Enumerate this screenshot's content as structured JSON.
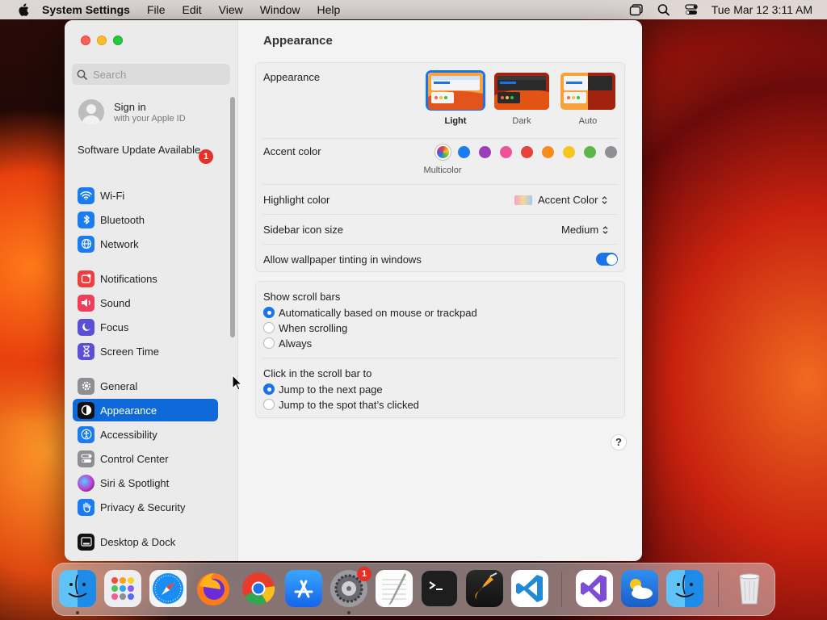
{
  "menubar": {
    "app_name": "System Settings",
    "menus": [
      "File",
      "Edit",
      "View",
      "Window",
      "Help"
    ],
    "datetime": "Tue Mar 12  3:11 AM"
  },
  "sidebar": {
    "search_placeholder": "Search",
    "signin_title": "Sign in",
    "signin_subtitle": "with your Apple ID",
    "update_label": "Software Update Available",
    "update_count": "1",
    "items": [
      {
        "label": "Wi-Fi",
        "icon": "wifi-icon",
        "color": "#1a7cf0"
      },
      {
        "label": "Bluetooth",
        "icon": "bluetooth-icon",
        "color": "#1a7cf0"
      },
      {
        "label": "Network",
        "icon": "globe-icon",
        "color": "#1a7cf0"
      },
      {
        "label": "Notifications",
        "icon": "bell-icon",
        "color": "#ef3e3e"
      },
      {
        "label": "Sound",
        "icon": "speaker-icon",
        "color": "#ef3e5a"
      },
      {
        "label": "Focus",
        "icon": "moon-icon",
        "color": "#5b4fd6"
      },
      {
        "label": "Screen Time",
        "icon": "hourglass-icon",
        "color": "#5b4fd6"
      },
      {
        "label": "General",
        "icon": "gear-icon",
        "color": "#8e8e93"
      },
      {
        "label": "Appearance",
        "icon": "appearance-icon",
        "color": "#111111"
      },
      {
        "label": "Accessibility",
        "icon": "accessibility-icon",
        "color": "#1a7cf0"
      },
      {
        "label": "Control Center",
        "icon": "control-center-icon",
        "color": "#8e8e93"
      },
      {
        "label": "Siri & Spotlight",
        "icon": "siri-icon",
        "color": "#c23bd4"
      },
      {
        "label": "Privacy & Security",
        "icon": "hand-icon",
        "color": "#1a7cf0"
      },
      {
        "label": "Desktop & Dock",
        "icon": "dock-icon",
        "color": "#111111"
      }
    ],
    "selected": "Appearance"
  },
  "main": {
    "title": "Appearance",
    "appearance": {
      "label": "Appearance",
      "options": [
        "Light",
        "Dark",
        "Auto"
      ],
      "selected": "Light"
    },
    "accent": {
      "label": "Accent color",
      "selected_name": "Multicolor",
      "colors": [
        "multicolor",
        "#1a7cf0",
        "#9a3fb5",
        "#f0529a",
        "#e8413a",
        "#f78c1e",
        "#f7c51e",
        "#5ab848",
        "#8e8e93"
      ]
    },
    "highlight": {
      "label": "Highlight color",
      "value": "Accent Color"
    },
    "sidebar_icon_size": {
      "label": "Sidebar icon size",
      "value": "Medium"
    },
    "tinting": {
      "label": "Allow wallpaper tinting in windows",
      "on": true
    },
    "scroll_bars": {
      "label": "Show scroll bars",
      "options": [
        "Automatically based on mouse or trackpad",
        "When scrolling",
        "Always"
      ],
      "selected": 0
    },
    "click_scroll": {
      "label": "Click in the scroll bar to",
      "options": [
        "Jump to the next page",
        "Jump to the spot that’s clicked"
      ],
      "selected": 0
    },
    "help": "?"
  },
  "dock": {
    "apps": [
      {
        "name": "finder-icon"
      },
      {
        "name": "launchpad-icon"
      },
      {
        "name": "safari-icon"
      },
      {
        "name": "firefox-icon"
      },
      {
        "name": "chrome-icon"
      },
      {
        "name": "app-store-icon"
      },
      {
        "name": "system-settings-icon",
        "badge": "1"
      },
      {
        "name": "textedit-icon"
      },
      {
        "name": "terminal-icon"
      },
      {
        "name": "garageband-icon"
      },
      {
        "name": "vscode-icon"
      },
      {
        "name": "visual-studio-icon"
      },
      {
        "name": "weather-icon"
      },
      {
        "name": "finder-alt-icon"
      },
      {
        "name": "trash-icon"
      }
    ],
    "settings_badge": "1"
  }
}
